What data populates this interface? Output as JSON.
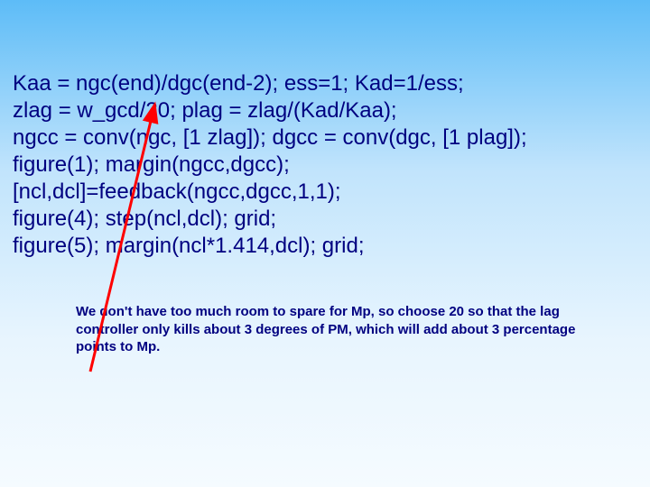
{
  "code": {
    "lines": [
      "Kaa = ngc(end)/dgc(end-2); ess=1; Kad=1/ess;",
      "zlag = w_gcd/20;  plag = zlag/(Kad/Kaa);",
      "ngcc = conv(ngc, [1 zlag]); dgcc = conv(dgc, [1 plag]);",
      "figure(1);  margin(ngcc,dgcc);",
      "[ncl,dcl]=feedback(ngcc,dgcc,1,1);",
      "figure(4); step(ncl,dcl); grid;",
      "figure(5); margin(ncl*1.414,dcl); grid;"
    ]
  },
  "annotation": {
    "text": "We don't have too much room to spare for Mp, so choose 20 so that the lag controller only kills about 3 degrees of PM, which will add about 3 percentage points to Mp."
  },
  "arrow": {
    "color": "#ff0000"
  }
}
